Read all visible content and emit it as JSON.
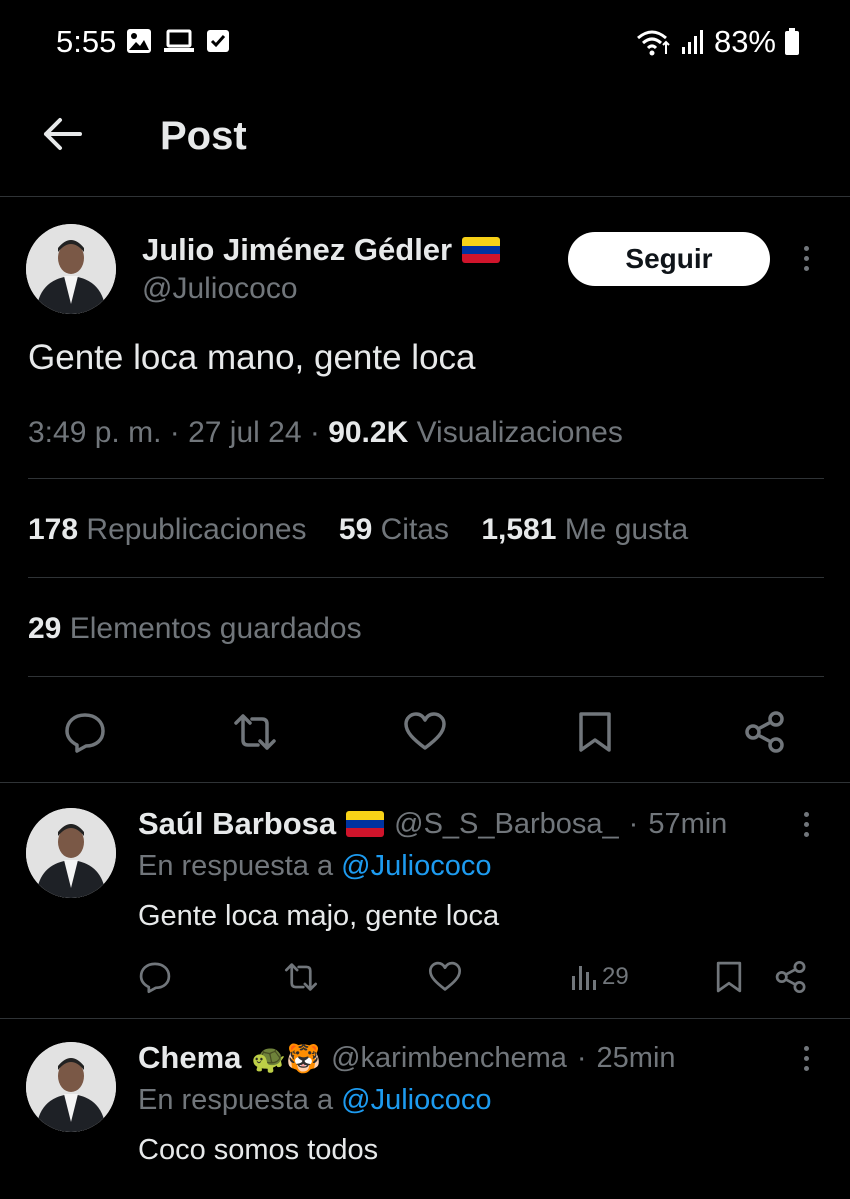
{
  "status_bar": {
    "time": "5:55",
    "battery": "83%",
    "icons": [
      "image-icon",
      "laptop-icon",
      "checkbox-icon",
      "wifi-icon",
      "signal-icon",
      "battery-icon"
    ]
  },
  "header": {
    "title": "Post",
    "back_icon": "arrow-left-icon"
  },
  "post": {
    "author_name": "Julio Jiménez Gédler",
    "author_flag": "venezuela-flag-icon",
    "author_handle": "@Juliococo",
    "follow_label": "Seguir",
    "text": "Gente loca mano, gente loca",
    "time": "3:49 p. m.",
    "date": "27 jul 24",
    "views": "90.2K",
    "views_label": "Visualizaciones",
    "reposts": "178",
    "reposts_label": "Republicaciones",
    "quotes": "59",
    "quotes_label": "Citas",
    "likes": "1,581",
    "likes_label": "Me gusta",
    "bookmarks": "29",
    "bookmarks_label": "Elementos guardados",
    "actions": [
      "reply-icon",
      "repost-icon",
      "like-icon",
      "bookmark-icon",
      "share-icon"
    ]
  },
  "replies": [
    {
      "name": "Saúl Barbosa",
      "emoji": "venezuela-flag-icon",
      "handle": "@S_S_Barbosa_",
      "time": "57min",
      "reply_prefix": "En respuesta a",
      "reply_mention": "@Juliococo",
      "text": "Gente loca majo, gente loca",
      "views": "29"
    },
    {
      "name": "Chema",
      "emoji": "🐢🐯",
      "handle": "@karimbenchema",
      "time": "25min",
      "reply_prefix": "En respuesta a",
      "reply_mention": "@Juliococo",
      "text": "Coco somos todos"
    }
  ],
  "colors": {
    "background": "#000000",
    "text": "#e7e9ea",
    "muted": "#71767b",
    "link": "#1d9bf0",
    "divider": "#2f3336"
  }
}
